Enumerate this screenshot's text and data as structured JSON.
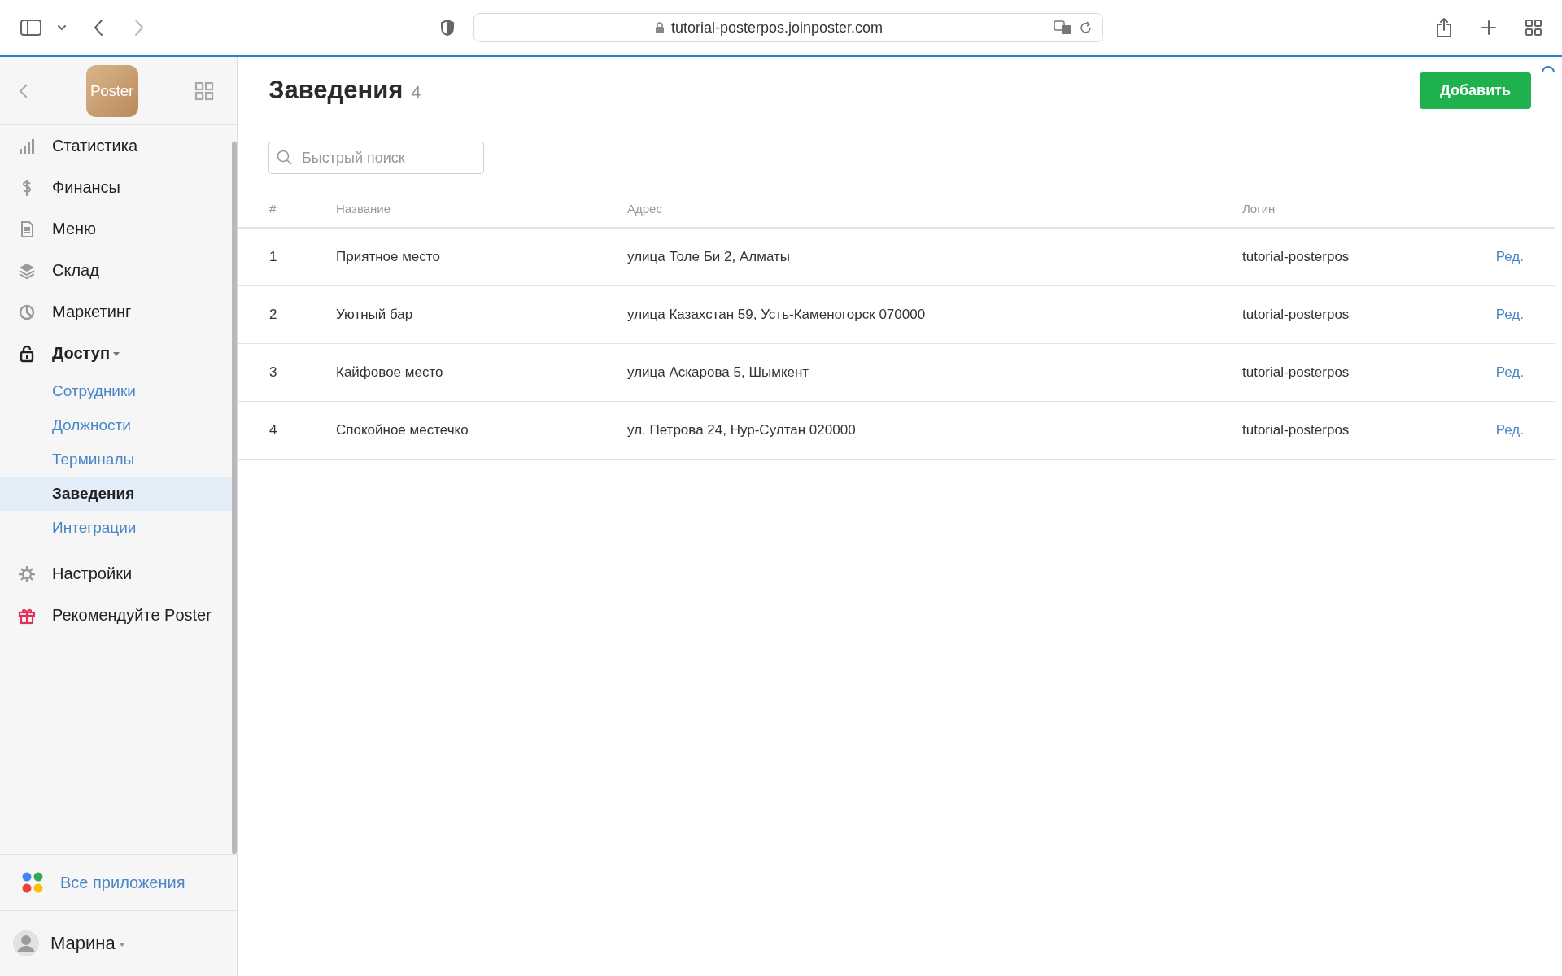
{
  "browser": {
    "url": "tutorial-posterpos.joinposter.com",
    "back_disabled": false,
    "forward_disabled": true
  },
  "sidebar": {
    "logo": "Poster",
    "items": [
      {
        "label": "Статистика",
        "expanded": false
      },
      {
        "label": "Финансы",
        "expanded": false
      },
      {
        "label": "Меню",
        "expanded": false
      },
      {
        "label": "Склад",
        "expanded": false
      },
      {
        "label": "Маркетинг",
        "expanded": false
      },
      {
        "label": "Доступ",
        "expanded": true,
        "children": [
          {
            "label": "Сотрудники",
            "selected": false
          },
          {
            "label": "Должности",
            "selected": false
          },
          {
            "label": "Терминалы",
            "selected": false
          },
          {
            "label": "Заведения",
            "selected": true
          },
          {
            "label": "Интеграции",
            "selected": false
          }
        ]
      },
      {
        "label": "Настройки",
        "expanded": false
      },
      {
        "label": "Рекомендуйте Poster",
        "expanded": false
      }
    ],
    "all_apps": "Все приложения",
    "user": "Марина"
  },
  "page": {
    "title": "Заведения",
    "count": "4",
    "add_button": "Добавить",
    "search": {
      "placeholder": "Быстрый поиск"
    }
  },
  "table": {
    "columns": [
      "#",
      "Название",
      "Адрес",
      "Логин"
    ],
    "rows": [
      {
        "cells": [
          "1",
          "Приятное место",
          "улица Толе Би 2, Алматы",
          "tutorial-posterpos"
        ],
        "action": "Ред."
      },
      {
        "cells": [
          "2",
          "Уютный бар",
          "улица Казахстан 59, Усть-Каменогорск 070000",
          "tutorial-posterpos"
        ],
        "action": "Ред."
      },
      {
        "cells": [
          "3",
          "Кайфовое место",
          "улица Аскарова 5, Шымкент",
          "tutorial-posterpos"
        ],
        "action": "Ред."
      },
      {
        "cells": [
          "4",
          "Спокойное местечко",
          "ул. Петрова 24, Нур-Султан 020000",
          "tutorial-posterpos"
        ],
        "action": "Ред."
      }
    ]
  }
}
